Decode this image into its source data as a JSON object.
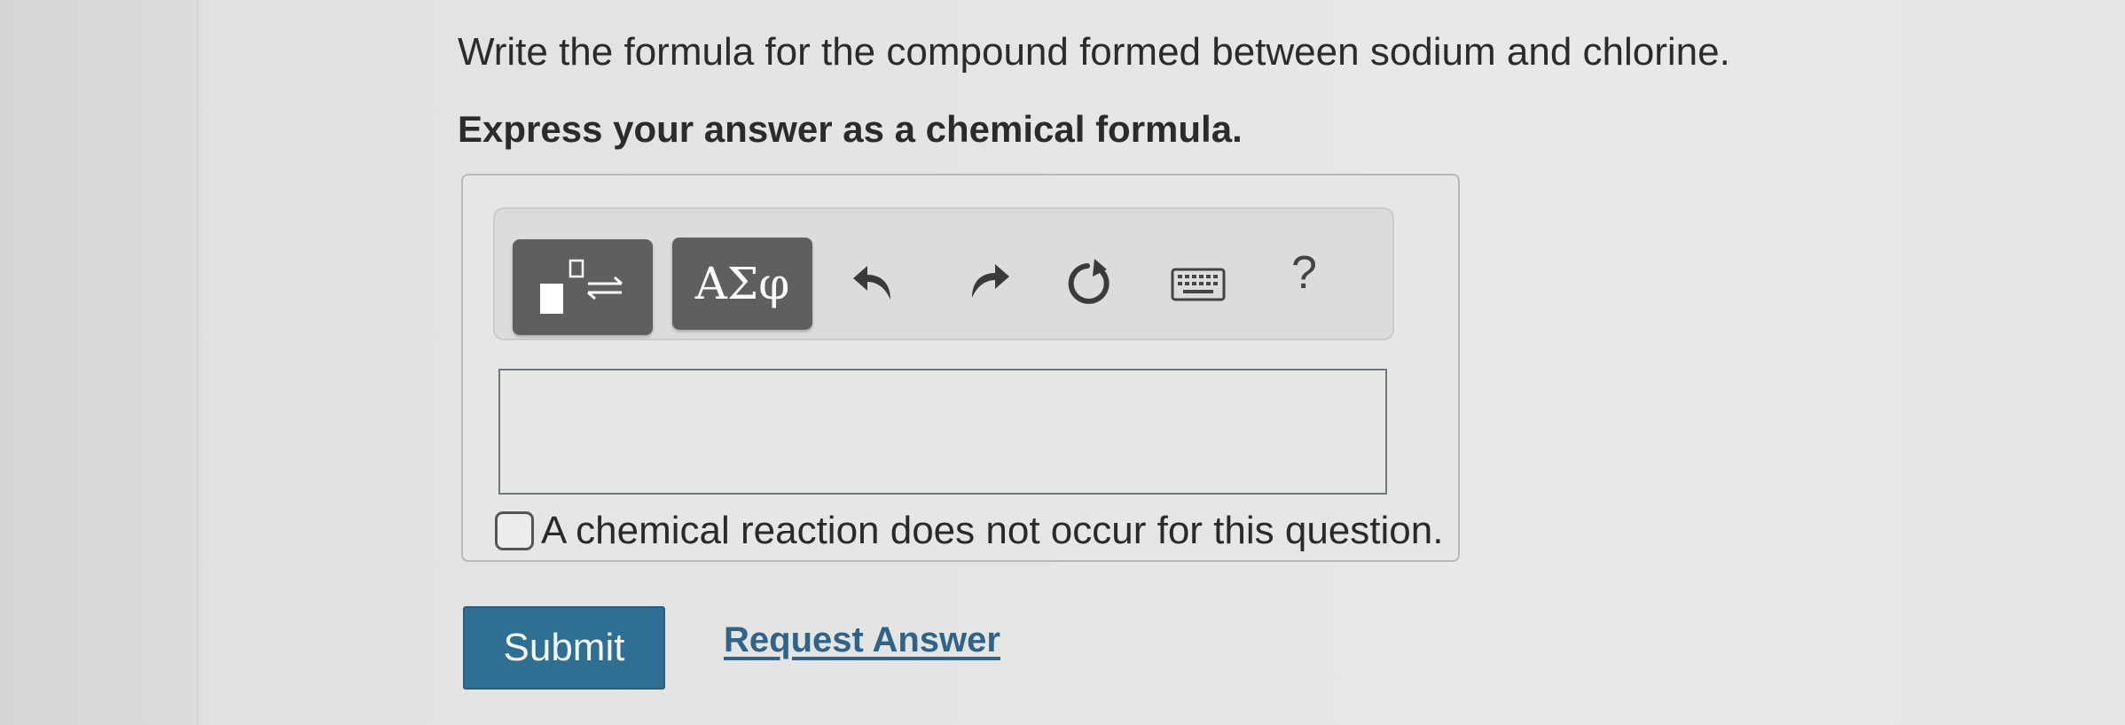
{
  "question": {
    "text": "Write the formula for the compound formed between sodium and chlorine.",
    "instruction": "Express your answer as a chemical formula."
  },
  "toolbar": {
    "templates_icon": "templates-subscript-arrows-icon",
    "symbols_label": "ΑΣφ",
    "undo_icon": "undo-icon",
    "redo_icon": "redo-icon",
    "reset_icon": "reset-icon",
    "keyboard_icon": "keyboard-icon",
    "help_label": "?"
  },
  "answer": {
    "value": "",
    "no_reaction_label": "A chemical reaction does not occur for this question.",
    "no_reaction_checked": false
  },
  "actions": {
    "submit_label": "Submit",
    "request_answer_label": "Request Answer"
  },
  "colors": {
    "submit_bg": "#2f6f93",
    "link": "#2f6389",
    "toolbar_button_bg": "#5e5f60"
  }
}
